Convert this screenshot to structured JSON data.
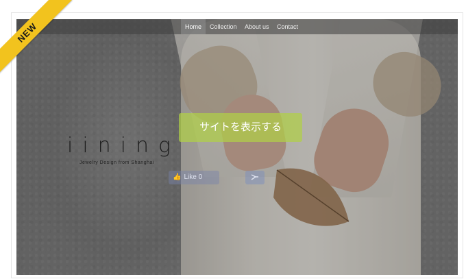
{
  "badge": {
    "label": "NEW",
    "color": "#f2c31e"
  },
  "nav": {
    "items": [
      {
        "label": "Home",
        "active": true
      },
      {
        "label": "Collection",
        "active": false
      },
      {
        "label": "About us",
        "active": false
      },
      {
        "label": "Contact",
        "active": false
      }
    ]
  },
  "brand": {
    "logo": "iining",
    "tagline": "Jewelry Design from Shanghai"
  },
  "cta": {
    "label": "サイトを表示する",
    "color": "#b0d046"
  },
  "social": {
    "like_label": "Like 0",
    "like_icon": "thumbs-up-icon",
    "share_icon": "share-icon"
  }
}
